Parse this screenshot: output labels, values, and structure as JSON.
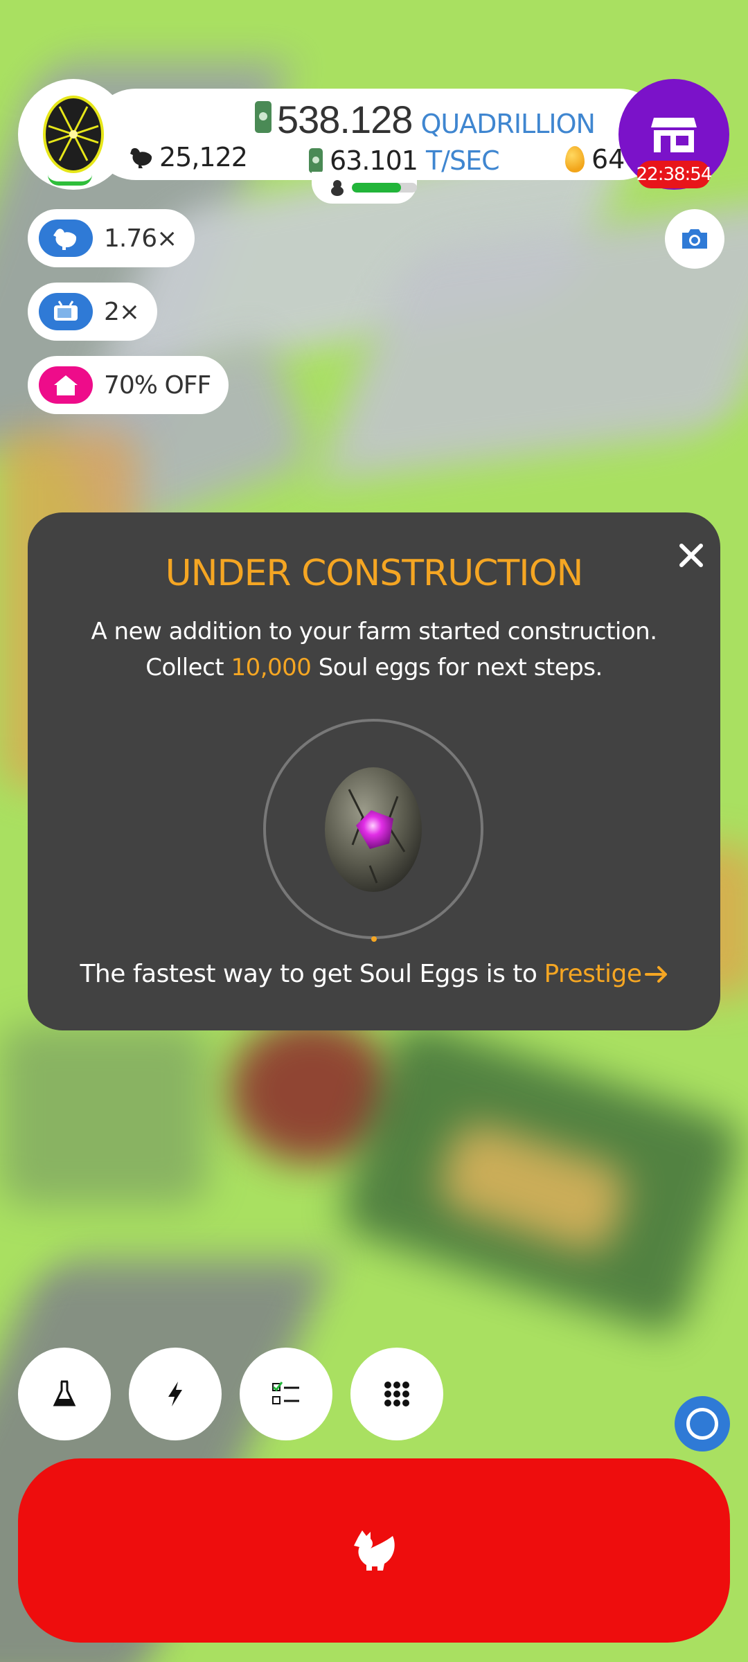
{
  "top_bar": {
    "money_amount": "538.128",
    "money_unit": "QUADRILLION",
    "chicken_count": "25,122",
    "earning_rate": "63.101",
    "earning_rate_unit": "T/SEC",
    "golden_eggs": "64",
    "shop_timer": "22:38:54",
    "hatchery_fill": 0.75
  },
  "boosts": [
    {
      "label": "1.76×",
      "icon": "chicken-icon",
      "color": "#2f7ad6"
    },
    {
      "label": "2×",
      "icon": "tv-icon",
      "color": "#2f7ad6"
    },
    {
      "label": "70% OFF",
      "icon": "house-icon",
      "color": "#ee0c8a"
    }
  ],
  "modal": {
    "title": "UNDER CONSTRUCTION",
    "desc_part1": "A new addition to your farm started construction. Collect",
    "desc_highlight": "10,000",
    "desc_part2": "Soul eggs for next steps.",
    "footer_text": "The fastest way to get Soul Eggs is to",
    "footer_link": "Prestige"
  },
  "colors": {
    "accent_orange": "#f5a623",
    "shop_purple": "#7b12c9",
    "hatch_red": "#ee0d0d",
    "accent_blue": "#3f86d0"
  },
  "nav": [
    {
      "name": "research",
      "icon": "flask-icon"
    },
    {
      "name": "boosts",
      "icon": "lightning-icon"
    },
    {
      "name": "missions",
      "icon": "checklist-icon"
    },
    {
      "name": "menu",
      "icon": "grid-icon"
    }
  ]
}
